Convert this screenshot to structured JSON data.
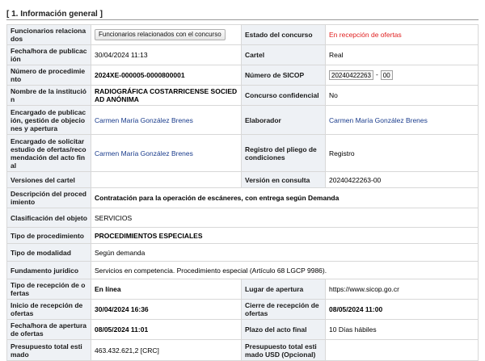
{
  "section": {
    "title": "[ 1. Información general ]"
  },
  "rows": {
    "funcionarios": {
      "label": "Funcionarios relacionados",
      "button": "Funcionarios relacionados con el concurso"
    },
    "estado": {
      "label": "Estado del concurso",
      "value": "En recepción de ofertas"
    },
    "fecha_pub": {
      "label": "Fecha/hora de publicación",
      "value": "30/04/2024 11:13"
    },
    "cartel": {
      "label": "Cartel",
      "value": "Real"
    },
    "num_proc": {
      "label": "Número de procedimiento",
      "value": "2024XE-000005-0000800001"
    },
    "sicop": {
      "label": "Número de SICOP",
      "part1": "20240422263",
      "sep": "-",
      "part2": "00"
    },
    "institucion": {
      "label": "Nombre de la institución",
      "value": "RADIOGRÁFICA COSTARRICENSE SOCIEDAD ANÓNIMA"
    },
    "confidencial": {
      "label": "Concurso confidencial",
      "value": "No"
    },
    "encargado_pub": {
      "label": "Encargado de publicación, gestión de objeciones y apertura",
      "value": "Carmen María González Brenes"
    },
    "elaborador": {
      "label": "Elaborador",
      "value": "Carmen María González Brenes"
    },
    "encargado_sol": {
      "label": "Encargado de solicitar estudio de ofertas/recomendación del acto final",
      "value": "Carmen María González Brenes"
    },
    "registro": {
      "label": "Registro del pliego de condiciones",
      "value": "Registro"
    },
    "versiones": {
      "label": "Versiones del cartel",
      "value": ""
    },
    "version_consulta": {
      "label": "Versión en consulta",
      "value": "20240422263-00"
    },
    "descripcion": {
      "label": "Descripción del procedimiento",
      "value": "Contratación para la operación de escáneres, con entrega según Demanda"
    },
    "clasificacion": {
      "label": "Clasificación del objeto",
      "value": "SERVICIOS"
    },
    "tipo_proc": {
      "label": "Tipo de procedimiento",
      "value": "PROCEDIMIENTOS ESPECIALES"
    },
    "tipo_mod": {
      "label": "Tipo de modalidad",
      "value": "Según demanda"
    },
    "fundamento": {
      "label": "Fundamento jurídico",
      "value": "Servicios en competencia. Procedimiento especial (Artículo 68 LGCP 9986)."
    },
    "tipo_recep": {
      "label": "Tipo de recepción de ofertas",
      "value": "En línea"
    },
    "lugar": {
      "label": "Lugar de apertura",
      "value": "https://www.sicop.go.cr"
    },
    "inicio": {
      "label": "Inicio de recepción de ofertas",
      "value": "30/04/2024 16:36"
    },
    "cierre": {
      "label": "Cierre de recepción de ofertas",
      "value": "08/05/2024 11:00"
    },
    "apertura": {
      "label": "Fecha/hora de apertura de ofertas",
      "value": "08/05/2024 11:01"
    },
    "plazo": {
      "label": "Plazo del acto final",
      "value": "10 Días hábiles"
    },
    "presupuesto": {
      "label": "Presupuesto total estimado",
      "value": "463.432.621,2 [CRC]"
    },
    "presupuesto_usd": {
      "label": "Presupuesto total estimado USD (Opcional)",
      "value": ""
    }
  }
}
